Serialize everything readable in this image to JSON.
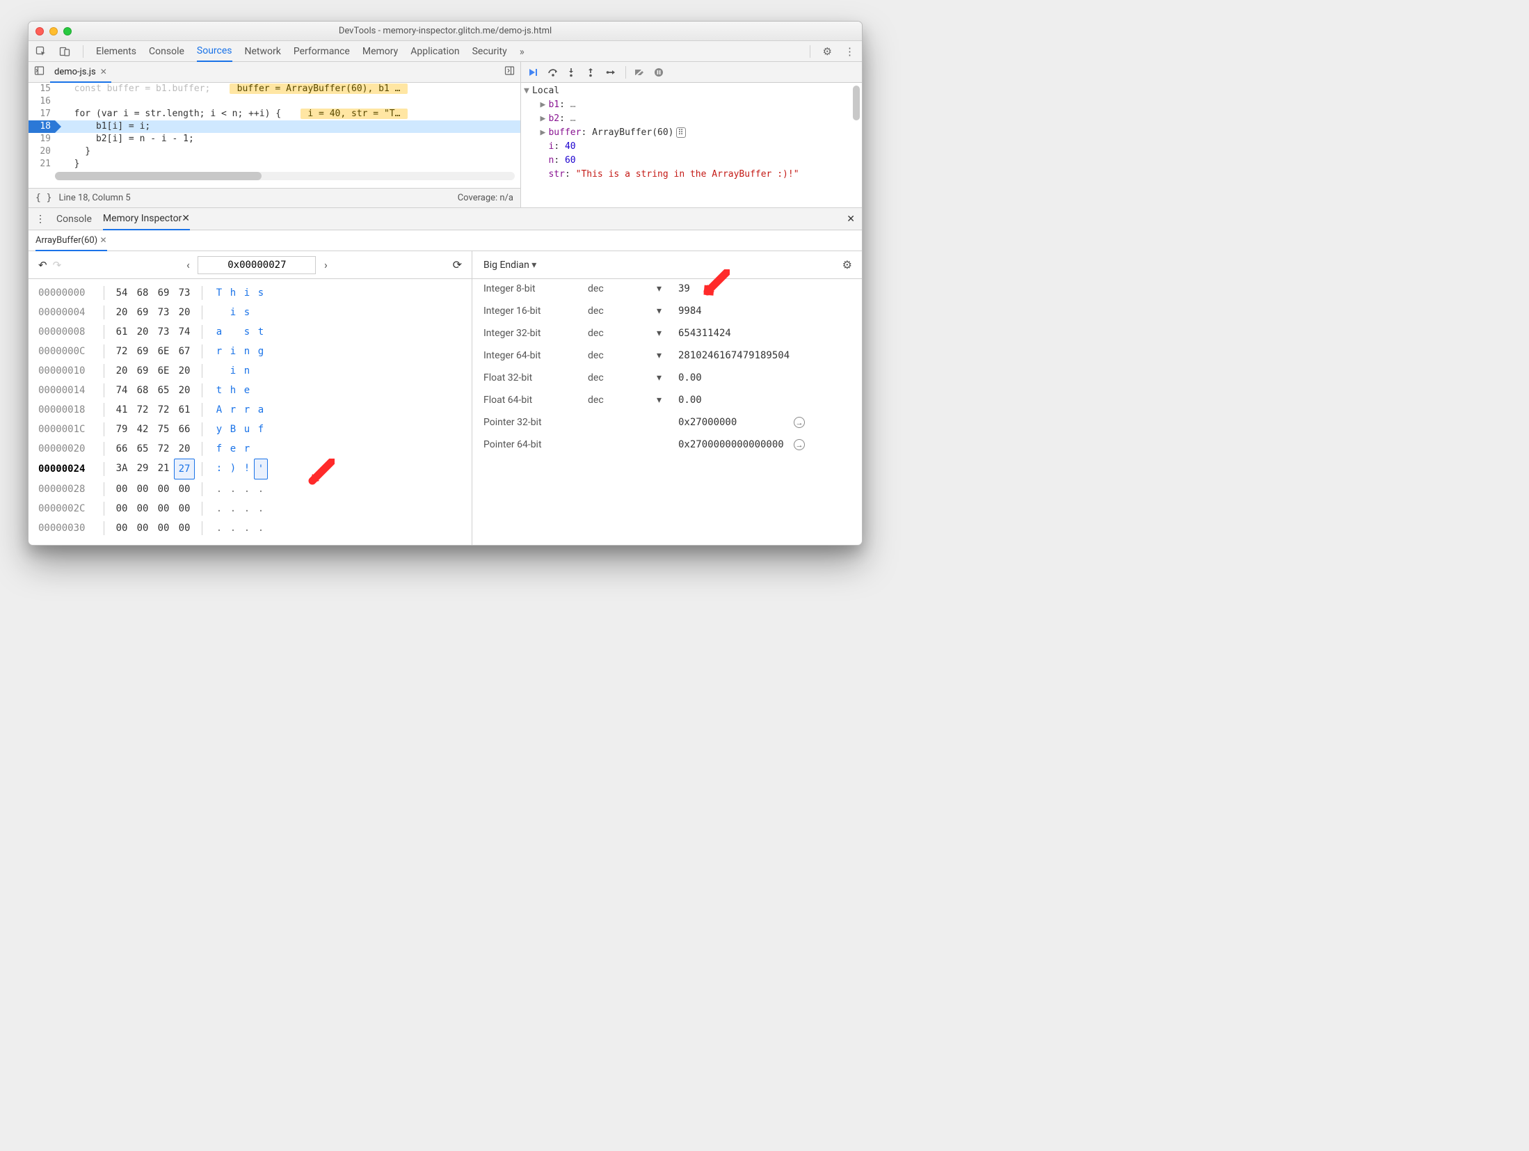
{
  "window": {
    "title": "DevTools - memory-inspector.glitch.me/demo-js.html"
  },
  "maintabs": {
    "items": [
      "Elements",
      "Console",
      "Sources",
      "Network",
      "Performance",
      "Memory",
      "Application",
      "Security"
    ],
    "overflow": "»",
    "active_index": 2
  },
  "file_tabs": {
    "active": "demo-js.js"
  },
  "code": {
    "lines": [
      {
        "n": 15,
        "txt": "const buffer = b1.buffer;",
        "eval": "buffer = ArrayBuffer(60), b1 …",
        "faded": true
      },
      {
        "n": 16,
        "txt": ""
      },
      {
        "n": 17,
        "txt": "for (var i = str.length; i < n; ++i) {",
        "eval": "i = 40, str = \"T…"
      },
      {
        "n": 18,
        "txt": "    b1[i] = i;",
        "hl": true
      },
      {
        "n": 19,
        "txt": "    b2[i] = n - i - 1;"
      },
      {
        "n": 20,
        "txt": "  }"
      },
      {
        "n": 21,
        "txt": "}",
        "cut": true
      }
    ],
    "status_left": "Line 18, Column 5",
    "status_right": "Coverage: n/a",
    "pretty_icon": "{ }"
  },
  "scope": {
    "header": "Local",
    "vars": [
      {
        "name": "b1",
        "val": "…",
        "expandable": true
      },
      {
        "name": "b2",
        "val": "…",
        "expandable": true
      },
      {
        "name": "buffer",
        "val": "ArrayBuffer(60)",
        "expandable": true,
        "icon": true
      },
      {
        "name": "i",
        "val": "40",
        "num": true
      },
      {
        "name": "n",
        "val": "60",
        "num": true
      },
      {
        "name": "str",
        "val": "\"This is a string in the ArrayBuffer :)!\"",
        "str": true
      }
    ]
  },
  "drawer": {
    "tabs": [
      "Console",
      "Memory Inspector"
    ],
    "active_index": 1
  },
  "mem": {
    "tab_label": "ArrayBuffer(60)",
    "address": "0x00000027",
    "rows": [
      {
        "addr": "00000000",
        "bytes": [
          "54",
          "68",
          "69",
          "73"
        ],
        "ascii": [
          "T",
          "h",
          "i",
          "s"
        ]
      },
      {
        "addr": "00000004",
        "bytes": [
          "20",
          "69",
          "73",
          "20"
        ],
        "ascii": [
          " ",
          "i",
          "s",
          " "
        ]
      },
      {
        "addr": "00000008",
        "bytes": [
          "61",
          "20",
          "73",
          "74"
        ],
        "ascii": [
          "a",
          " ",
          "s",
          "t"
        ]
      },
      {
        "addr": "0000000C",
        "bytes": [
          "72",
          "69",
          "6E",
          "67"
        ],
        "ascii": [
          "r",
          "i",
          "n",
          "g"
        ]
      },
      {
        "addr": "00000010",
        "bytes": [
          "20",
          "69",
          "6E",
          "20"
        ],
        "ascii": [
          " ",
          "i",
          "n",
          " "
        ]
      },
      {
        "addr": "00000014",
        "bytes": [
          "74",
          "68",
          "65",
          "20"
        ],
        "ascii": [
          "t",
          "h",
          "e",
          " "
        ]
      },
      {
        "addr": "00000018",
        "bytes": [
          "41",
          "72",
          "72",
          "61"
        ],
        "ascii": [
          "A",
          "r",
          "r",
          "a"
        ]
      },
      {
        "addr": "0000001C",
        "bytes": [
          "79",
          "42",
          "75",
          "66"
        ],
        "ascii": [
          "y",
          "B",
          "u",
          "f"
        ]
      },
      {
        "addr": "00000020",
        "bytes": [
          "66",
          "65",
          "72",
          "20"
        ],
        "ascii": [
          "f",
          "e",
          "r",
          " "
        ]
      },
      {
        "addr": "00000024",
        "bytes": [
          "3A",
          "29",
          "21",
          "27"
        ],
        "ascii": [
          ":",
          ")",
          "!",
          "'"
        ],
        "sel": 3
      },
      {
        "addr": "00000028",
        "bytes": [
          "00",
          "00",
          "00",
          "00"
        ],
        "ascii": [
          ".",
          ".",
          ".",
          "."
        ]
      },
      {
        "addr": "0000002C",
        "bytes": [
          "00",
          "00",
          "00",
          "00"
        ],
        "ascii": [
          ".",
          ".",
          ".",
          "."
        ]
      },
      {
        "addr": "00000030",
        "bytes": [
          "00",
          "00",
          "00",
          "00"
        ],
        "ascii": [
          ".",
          ".",
          ".",
          "."
        ]
      }
    ]
  },
  "values": {
    "endian": "Big Endian",
    "rows": [
      {
        "label": "Integer 8-bit",
        "enc": "dec",
        "val": "39"
      },
      {
        "label": "Integer 16-bit",
        "enc": "dec",
        "val": "9984"
      },
      {
        "label": "Integer 32-bit",
        "enc": "dec",
        "val": "654311424"
      },
      {
        "label": "Integer 64-bit",
        "enc": "dec",
        "val": "2810246167479189504"
      },
      {
        "label": "Float 32-bit",
        "enc": "dec",
        "val": "0.00"
      },
      {
        "label": "Float 64-bit",
        "enc": "dec",
        "val": "0.00"
      },
      {
        "label": "Pointer 32-bit",
        "enc": "",
        "val": "0x27000000",
        "goto": true
      },
      {
        "label": "Pointer 64-bit",
        "enc": "",
        "val": "0x2700000000000000",
        "goto": true
      }
    ]
  }
}
